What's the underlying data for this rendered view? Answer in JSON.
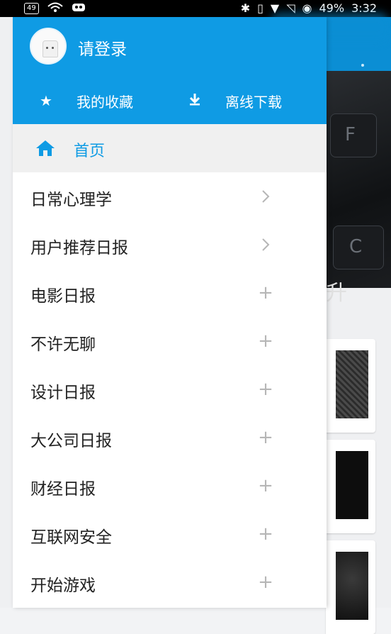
{
  "status_bar": {
    "left_badge": "49",
    "battery_text": "49%",
    "time": "3:32"
  },
  "drawer": {
    "login_text": "请登录",
    "favorites_label": "我的收藏",
    "offline_label": "离线下载",
    "home_label": "首页",
    "items": [
      {
        "label": "日常心理学",
        "action": "chevron"
      },
      {
        "label": "用户推荐日报",
        "action": "chevron"
      },
      {
        "label": "电影日报",
        "action": "plus"
      },
      {
        "label": "不许无聊",
        "action": "plus"
      },
      {
        "label": "设计日报",
        "action": "plus"
      },
      {
        "label": "大公司日报",
        "action": "plus"
      },
      {
        "label": "财经日报",
        "action": "plus"
      },
      {
        "label": "互联网安全",
        "action": "plus"
      },
      {
        "label": "开始游戏",
        "action": "plus"
      }
    ]
  },
  "background": {
    "banner_text_fragment": "升",
    "key_labels": [
      "F",
      "C"
    ]
  },
  "colors": {
    "accent": "#0f9be4",
    "header_bg": "#0f9be4",
    "home_row_bg": "#f0f0f0",
    "text": "#222222",
    "muted_icon": "#b6b6b6"
  }
}
